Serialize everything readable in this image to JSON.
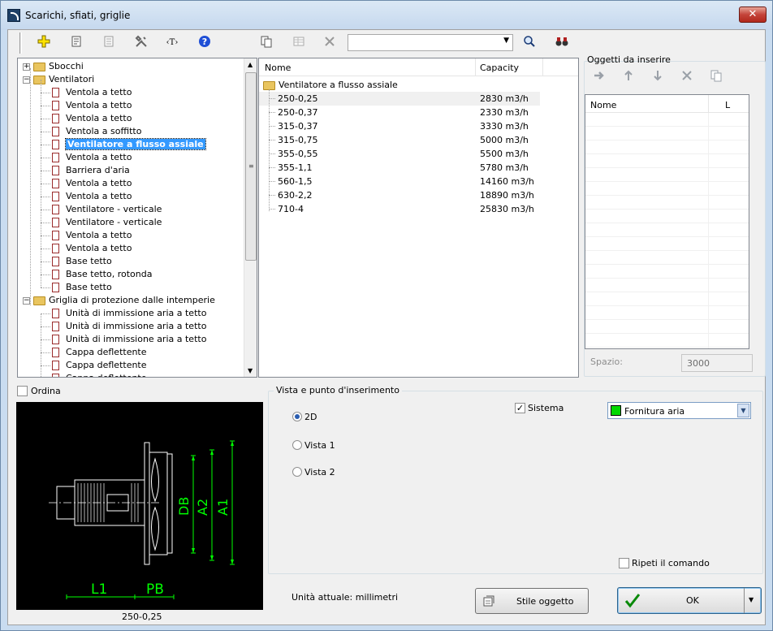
{
  "window": {
    "title": "Scarichi, sfiati, griglie",
    "close_icon": "close-icon"
  },
  "toolbar": {
    "icons": [
      "add-icon",
      "properties-icon",
      "list-icon",
      "tools-icon",
      "text-icon",
      "help-icon",
      "copy-icon",
      "table-icon",
      "delete-icon",
      "search-icon",
      "find-icon"
    ],
    "search_value": ""
  },
  "tree": {
    "items": [
      {
        "level": 0,
        "kind": "folder",
        "expander": "+",
        "label": "Sbocchi"
      },
      {
        "level": 0,
        "kind": "folder",
        "expander": "−",
        "label": "Ventilatori"
      },
      {
        "level": 1,
        "kind": "doc",
        "label": "Ventola a tetto"
      },
      {
        "level": 1,
        "kind": "doc",
        "label": "Ventola a tetto"
      },
      {
        "level": 1,
        "kind": "doc",
        "label": "Ventola a tetto"
      },
      {
        "level": 1,
        "kind": "doc",
        "label": "Ventola a soffitto"
      },
      {
        "level": 1,
        "kind": "doc",
        "label": "Ventilatore a flusso assiale",
        "selected": true
      },
      {
        "level": 1,
        "kind": "doc",
        "label": "Ventola a tetto"
      },
      {
        "level": 1,
        "kind": "doc",
        "label": "Barriera d'aria"
      },
      {
        "level": 1,
        "kind": "doc",
        "label": "Ventola a tetto"
      },
      {
        "level": 1,
        "kind": "doc",
        "label": "Ventola a tetto"
      },
      {
        "level": 1,
        "kind": "doc",
        "label": "Ventilatore - verticale"
      },
      {
        "level": 1,
        "kind": "doc",
        "label": "Ventilatore - verticale"
      },
      {
        "level": 1,
        "kind": "doc",
        "label": "Ventola a tetto"
      },
      {
        "level": 1,
        "kind": "doc",
        "label": "Ventola a tetto"
      },
      {
        "level": 1,
        "kind": "doc",
        "label": "Base tetto"
      },
      {
        "level": 1,
        "kind": "doc",
        "label": "Base tetto, rotonda"
      },
      {
        "level": 1,
        "kind": "doc",
        "label": "Base tetto"
      },
      {
        "level": 0,
        "kind": "folder",
        "expander": "−",
        "label": "Griglia di protezione dalle intemperie"
      },
      {
        "level": 1,
        "kind": "doc",
        "label": "Unità di immissione aria a tetto"
      },
      {
        "level": 1,
        "kind": "doc",
        "label": "Unità di immissione aria a tetto"
      },
      {
        "level": 1,
        "kind": "doc",
        "label": "Unità di immissione aria a tetto"
      },
      {
        "level": 1,
        "kind": "doc",
        "label": "Cappa deflettente"
      },
      {
        "level": 1,
        "kind": "doc",
        "label": "Cappa deflettente"
      },
      {
        "level": 1,
        "kind": "doc",
        "label": "Cappa deflettente"
      }
    ]
  },
  "list": {
    "headers": {
      "name": "Nome",
      "capacity": "Capacity"
    },
    "group": "Ventilatore a flusso assiale",
    "rows": [
      {
        "name": "250-0,25",
        "capacity": "2830 m3/h",
        "selected": true
      },
      {
        "name": "250-0,37",
        "capacity": "2330 m3/h"
      },
      {
        "name": "315-0,37",
        "capacity": "3330 m3/h"
      },
      {
        "name": "315-0,75",
        "capacity": "5000 m3/h"
      },
      {
        "name": "355-0,55",
        "capacity": "5500 m3/h"
      },
      {
        "name": "355-1,1",
        "capacity": "5780 m3/h"
      },
      {
        "name": "560-1,5",
        "capacity": "14160 m3/h"
      },
      {
        "name": "630-2,2",
        "capacity": "18890 m3/h"
      },
      {
        "name": "710-4",
        "capacity": "25830 m3/h"
      }
    ]
  },
  "objects": {
    "title": "Oggetti da inserire",
    "icons": [
      "arrow-right-icon",
      "arrow-up-icon",
      "arrow-down-icon",
      "delete-icon",
      "copy-icon"
    ],
    "headers": {
      "name": "Nome",
      "l": "L"
    },
    "spazio_label": "Spazio:",
    "spazio_value": "3000"
  },
  "ordina": {
    "label": "Ordina",
    "checked": false
  },
  "preview": {
    "caption": "250-0,25",
    "dims": {
      "db": "DB",
      "a2": "A2",
      "a1": "A1",
      "l1": "L1",
      "pb": "PB"
    },
    "line_color": "#00ff00"
  },
  "view": {
    "group_title": "Vista e punto d'inserimento",
    "options": [
      {
        "label": "2D",
        "checked": true
      },
      {
        "label": "Vista 1",
        "checked": false
      },
      {
        "label": "Vista 2",
        "checked": false
      }
    ],
    "sistema": {
      "label": "Sistema",
      "checked": true
    },
    "system_value": "Fornitura aria",
    "system_color": "#00d800",
    "ripeti": {
      "label": "Ripeti il comando",
      "checked": false
    }
  },
  "footer": {
    "units": "Unità attuale: millimetri",
    "style_button": "Stile oggetto",
    "ok_button": "OK"
  }
}
